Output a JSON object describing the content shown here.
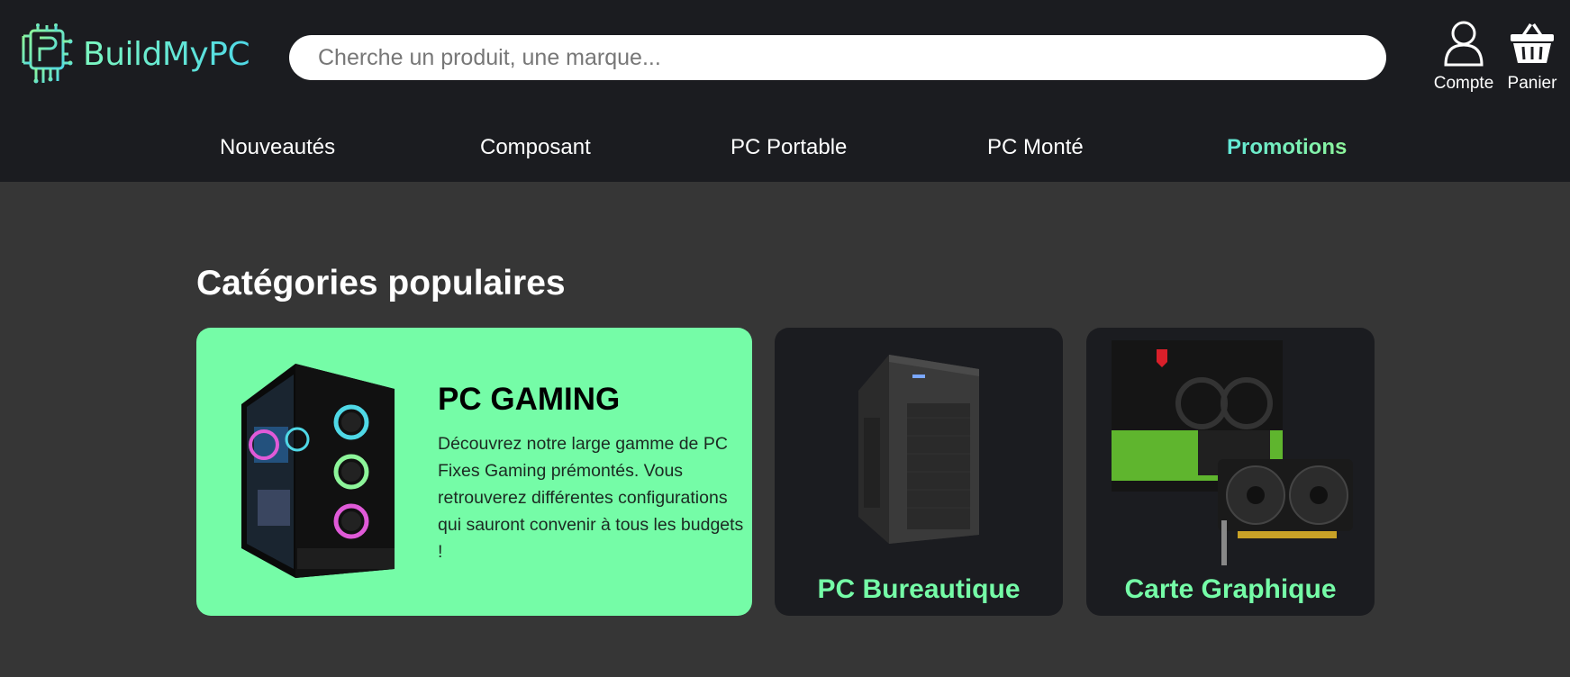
{
  "brand": {
    "name": "BuildMyPC",
    "logo_icon": "circuit-board-icon"
  },
  "search": {
    "placeholder": "Cherche un produit, une marque...",
    "value": ""
  },
  "header_actions": {
    "account_label": "Compte",
    "account_icon": "user-icon",
    "cart_label": "Panier",
    "cart_icon": "basket-icon"
  },
  "nav": {
    "items": [
      {
        "label": "Nouveautés"
      },
      {
        "label": "Composant"
      },
      {
        "label": "PC Portable"
      },
      {
        "label": "PC Monté"
      },
      {
        "label": "Promotions",
        "highlight": true
      }
    ]
  },
  "section": {
    "title": "Catégories populaires"
  },
  "categories": {
    "featured": {
      "title": "PC GAMING",
      "description": "Découvrez notre large gamme de PC Fixes Gaming prémontés. Vous retrouverez différentes configurations qui sauront convenir à tous les budgets !",
      "image_icon": "gaming-pc-tower-icon"
    },
    "items": [
      {
        "title": "PC Bureautique",
        "image_icon": "office-pc-tower-icon"
      },
      {
        "title": "Carte Graphique",
        "image_icon": "graphics-card-icon"
      }
    ]
  },
  "colors": {
    "header_bg": "#1b1c20",
    "page_bg": "#363636",
    "accent_green": "#75fca7",
    "accent_cyan": "#4fd8e6"
  }
}
